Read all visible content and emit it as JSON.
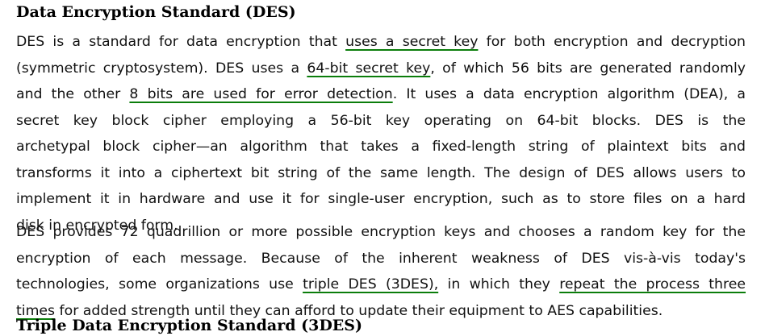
{
  "section": {
    "title": "Data Encryption Standard (DES)"
  },
  "paragraph1": {
    "l1_a": "DES is a standard for data encryption that ",
    "l1_hl": "uses a secret key",
    "l1_b": " for both encryption and decryption",
    "l2": "(symmetric cryptosystem). DES uses a ",
    "l2_hl": "64-bit secret key",
    "l2_b": ", of which 56 bits are generated randomly",
    "l3_a": "and the other ",
    "l3_hl": "8 bits are used for error detection",
    "l3_b": ". It uses a data encryption algorithm (DEA), a",
    "l4": "secret key block cipher employing a 56-bit key operating on 64-bit blocks. DES is the",
    "l5": "archetypal block cipher—an algorithm that takes a fixed-length string of plaintext bits and",
    "l6": "transforms it into a ciphertext bit string of the same length. The design of DES allows users to",
    "l7": "implement it in hardware and use it for single-user encryption, such as to store files on a hard",
    "l8": "disk in encrypted form."
  },
  "paragraph2": {
    "l1": "DES provides 72 quadrillion or more possible encryption keys and chooses a random key for the",
    "l2": "encryption of each message. Because of the inherent weakness of DES vis-à-vis today's",
    "l3_a": "technologies, some organizations use ",
    "l3_hl1": "triple DES (3DES),",
    "l3_b": " in which they ",
    "l3_hl2": "repeat the process three",
    "l4_hl": "times",
    "l4_b": " for added strength until they can afford to update their equipment to AES capabilities."
  },
  "next_section": {
    "title": "Triple Data Encryption Standard (3DES)"
  }
}
